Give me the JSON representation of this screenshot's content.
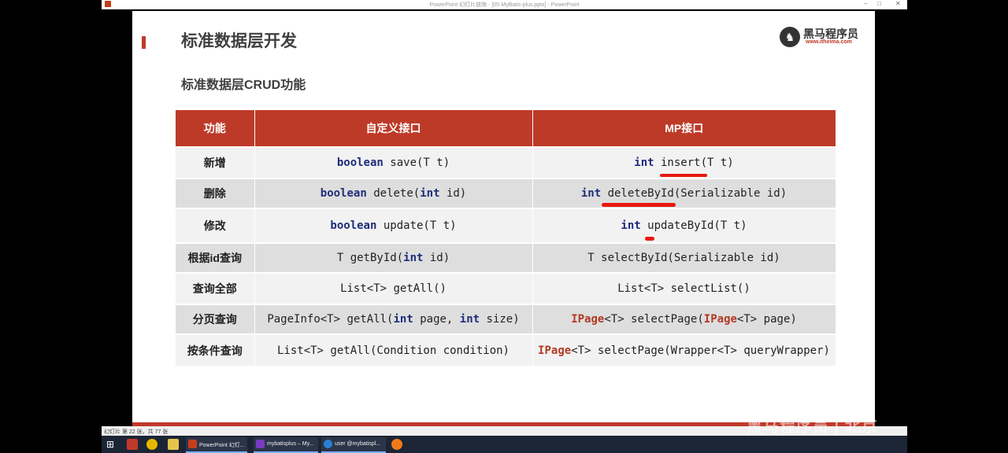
{
  "window": {
    "title": "PowerPoint 幻灯片放映 - [05-MyBatis-plus.pptx] - PowerPoint"
  },
  "slide": {
    "title": "标准数据层开发",
    "subtitle": "标准数据层CRUD功能",
    "logo": {
      "name": "黑马程序员",
      "url": "www.itheima.com"
    },
    "table": {
      "headers": [
        "功能",
        "自定义接口",
        "MP接口"
      ],
      "rows": [
        {
          "fn": "新增",
          "custom": "boolean save(T t)",
          "mp": "int insert(T t)"
        },
        {
          "fn": "删除",
          "custom": "boolean delete(int id)",
          "mp": "int deleteById(Serializable id)"
        },
        {
          "fn": "修改",
          "custom": "boolean update(T t)",
          "mp": "int updateById(T t)"
        },
        {
          "fn": "根据id查询",
          "custom": "T getById(int id)",
          "mp": "T selectById(Serializable id)"
        },
        {
          "fn": "查询全部",
          "custom": "List<T> getAll()",
          "mp": "List<T> selectList()"
        },
        {
          "fn": "分页查询",
          "custom": "PageInfo<T> getAll(int page, int size)",
          "mp": "IPage<T> selectPage(IPage<T> page)"
        },
        {
          "fn": "按条件查询",
          "custom": "List<T> getAll(Condition condition)",
          "mp": "IPage<T> selectPage(Wrapper<T> queryWrapper)"
        }
      ]
    }
  },
  "status": {
    "text": "幻灯片 第 22 张，共 77 张"
  },
  "watermark": "黑马程序员 | 北京",
  "taskbar": {
    "apps": [
      {
        "label": "PowerPoint 幻灯..."
      },
      {
        "label": "mybatisplus – My..."
      },
      {
        "label": "user @mybatispl..."
      }
    ]
  },
  "colors": {
    "accent": "#be3a28",
    "keyword": "#1f2d7a",
    "ipage": "#b23a24",
    "annotation": "#e8190f"
  }
}
